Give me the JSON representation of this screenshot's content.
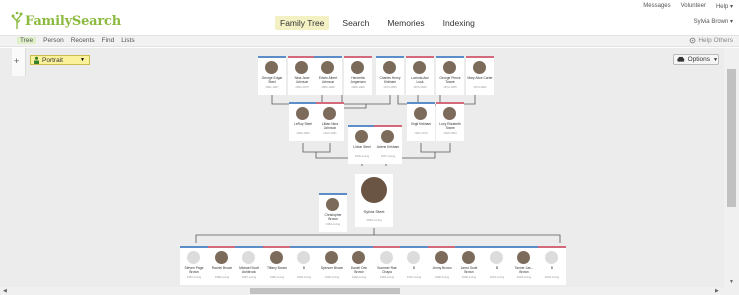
{
  "header": {
    "logo_text": "FamilySearch",
    "nav": [
      "Family Tree",
      "Search",
      "Memories",
      "Indexing"
    ],
    "active_nav": "Family Tree",
    "util": [
      "Messages",
      "Volunteer",
      "Help ▾"
    ],
    "user": "Sylvia Brown ▾"
  },
  "subnav": {
    "items": [
      "Tree",
      "Person",
      "Recents",
      "Find",
      "Lists"
    ],
    "active": "Tree",
    "help_others": "Help Others"
  },
  "toolbar": {
    "plus": "+",
    "view_label": "Portrait",
    "options_label": "Options"
  },
  "colors": {
    "accent": "#8cba3f",
    "male": "#5b8ec9",
    "female": "#d26a7b",
    "view_bg": "#fbf19a"
  },
  "tree": {
    "gen4": [
      {
        "name": "George Edgar Steel",
        "dates": "1891-1967",
        "sex": "m",
        "photo": true
      },
      {
        "name": "Nina Jane Johnson",
        "dates": "1893-1975",
        "sex": "f",
        "photo": true
      },
      {
        "name": "Edwin Albert Johnson",
        "dates": "1883-1968",
        "sex": "m",
        "photo": true
      },
      {
        "name": "Henrietta Jorgensen",
        "dates": "1886-1966",
        "sex": "f",
        "photo": true
      },
      {
        "name": "Charles Henry Kirkham",
        "dates": "1874-1955",
        "sex": "m",
        "photo": true
      },
      {
        "name": "Lucinda Ann Lusk",
        "dates": "1876-1945",
        "sex": "f",
        "photo": true
      },
      {
        "name": "George Pierce Towne",
        "dates": "1872-1955",
        "sex": "m",
        "photo": true
      },
      {
        "name": "Mary Alice Carter",
        "dates": "1873-1961",
        "sex": "f",
        "photo": true
      }
    ],
    "gen3": [
      {
        "name": "LeRoy Steel",
        "dates": "1909-1990",
        "sex": "m",
        "photo": true
      },
      {
        "name": "Lillian Nina Johnson",
        "dates": "1912-1991",
        "sex": "f",
        "photo": true
      },
      {
        "name": "Virgil Kirkham",
        "dates": "1903-1973",
        "sex": "m",
        "photo": true
      },
      {
        "name": "Lucy Elizabeth Towne",
        "dates": "1906-1993",
        "sex": "f",
        "photo": true
      }
    ],
    "gen2": [
      {
        "name": "Linton Steel",
        "dates": "1935-Living",
        "sex": "m",
        "photo": true
      },
      {
        "name": "Arlene Kirkham",
        "dates": "1937-Living",
        "sex": "f",
        "photo": true
      }
    ],
    "spouse": {
      "name": "Christopher Brown",
      "dates": "1964-Living",
      "sex": "m",
      "photo": true
    },
    "focus": {
      "name": "Sylvia Steel",
      "dates": "1966-Living"
    },
    "children": [
      {
        "name": "Steven Page Brown",
        "dates": "1987-Living",
        "sex": "m",
        "photo": false
      },
      {
        "name": "Rachel Brown",
        "dates": "1988-Living",
        "sex": "f",
        "photo": true
      },
      {
        "name": "Michael Scott Ashbrook",
        "dates": "1987-Living",
        "sex": "m",
        "photo": false
      },
      {
        "name": "Tiffany Brown",
        "dates": "1990-Living",
        "sex": "f",
        "photo": true
      },
      {
        "name": "B",
        "dates": "1992-Living",
        "sex": "m",
        "photo": false
      },
      {
        "name": "Spencer Brown",
        "dates": "1992-Living",
        "sex": "m",
        "photo": true
      },
      {
        "name": "Daniel Orin Brown",
        "dates": "1994-Living",
        "sex": "m",
        "photo": true
      },
      {
        "name": "Summer Rae Chapa",
        "dates": "1994-Living",
        "sex": "f",
        "photo": false
      },
      {
        "name": "B",
        "dates": "1997-Living",
        "sex": "m",
        "photo": false
      },
      {
        "name": "Jenny Brown",
        "dates": "1998-Living",
        "sex": "f",
        "photo": true
      },
      {
        "name": "Jared Scott Brown",
        "dates": "2000-Living",
        "sex": "m",
        "photo": true
      },
      {
        "name": "B",
        "dates": "2001-Living",
        "sex": "m",
        "photo": false
      },
      {
        "name": "Tanner Jas... Brown",
        "dates": "2003-Living",
        "sex": "m",
        "photo": true
      },
      {
        "name": "B",
        "dates": "2004-Living",
        "sex": "f",
        "photo": false
      }
    ]
  }
}
